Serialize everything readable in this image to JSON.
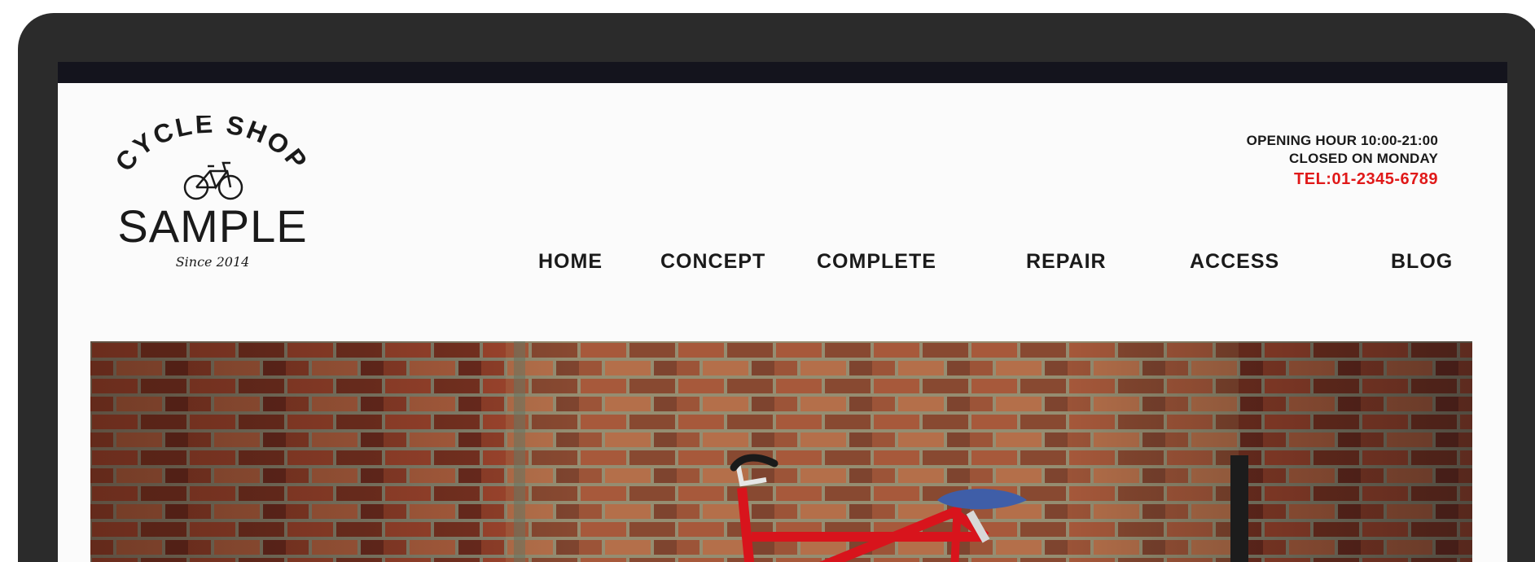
{
  "logo": {
    "arc_text": "CYCLE SHOP",
    "name": "SAMPLE",
    "since": "Since 2014"
  },
  "info": {
    "hours": "OPENING HOUR 10:00-21:00",
    "closed": "CLOSED ON MONDAY",
    "tel": "TEL:01-2345-6789"
  },
  "nav": {
    "items": [
      {
        "label": "HOME"
      },
      {
        "label": "CONCEPT"
      },
      {
        "label": "COMPLETE"
      },
      {
        "label": "REPAIR"
      },
      {
        "label": "ACCESS"
      },
      {
        "label": "BLOG"
      }
    ]
  },
  "colors": {
    "frame": "#2b2b2b",
    "screen_bg": "#fbfbfb",
    "tel": "#e01919",
    "bike": "#d8141c",
    "saddle": "#3f5ea8"
  }
}
